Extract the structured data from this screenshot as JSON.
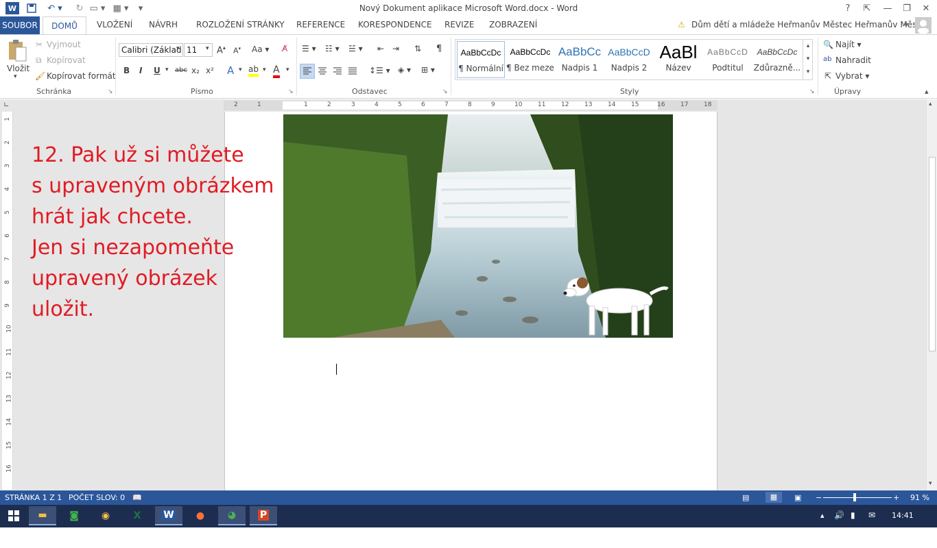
{
  "window": {
    "title": "Nový Dokument aplikace Microsoft Word.docx - Word",
    "help": "?",
    "min": "—",
    "max": "❐",
    "close": "✕"
  },
  "tabs": {
    "file": "SOUBOR",
    "items": [
      "DOMŮ",
      "VLOŽENÍ",
      "NÁVRH",
      "ROZLOŽENÍ STRÁNKY",
      "REFERENCE",
      "KORESPONDENCE",
      "REVIZE",
      "ZOBRAZENÍ"
    ],
    "account": "Dům dětí a mládeže Heřmanův Městec Heřmanův Městec"
  },
  "clipboard": {
    "paste": "Vložit",
    "cut": "Vyjmout",
    "copy": "Kopírovat",
    "format_painter": "Kopírovat formát",
    "label": "Schránka"
  },
  "font": {
    "name": "Calibri (Základ",
    "size": "11",
    "case": "Aa",
    "bold": "B",
    "italic": "I",
    "underline": "U",
    "strike": "abc",
    "sub": "x₂",
    "sup": "x²",
    "label": "Písmo"
  },
  "paragraph": {
    "label": "Odstavec",
    "pilcrow": "¶"
  },
  "styles": {
    "label": "Styly",
    "items": [
      {
        "preview": "AaBbCcDc",
        "name": "¶ Normální"
      },
      {
        "preview": "AaBbCcDc",
        "name": "¶ Bez mezer"
      },
      {
        "preview": "AaBbCc",
        "name": "Nadpis 1"
      },
      {
        "preview": "AaBbCcD",
        "name": "Nadpis 2"
      },
      {
        "preview": "AaBl",
        "name": "Název"
      },
      {
        "preview": "AaBbCcD",
        "name": "Podtitul"
      },
      {
        "preview": "AaBbCcDc",
        "name": "Zdůrazně..."
      }
    ]
  },
  "editing": {
    "find": "Najít",
    "replace": "Nahradit",
    "select": "Vybrat",
    "label": "Úpravy"
  },
  "ruler": {
    "numbers": [
      "2",
      "1",
      "1",
      "2",
      "3",
      "4",
      "5",
      "6",
      "7",
      "8",
      "9",
      "10",
      "11",
      "12",
      "13",
      "14",
      "15",
      "16",
      "17",
      "18"
    ],
    "vnumbers": [
      "1",
      "2",
      "3",
      "4",
      "5",
      "6",
      "7",
      "8",
      "9",
      "10",
      "11",
      "12",
      "13",
      "14",
      "15",
      "16"
    ]
  },
  "document": {
    "lines": [
      "12. Pak už si můžete",
      "s upraveným obrázkem",
      "hrát jak chcete.",
      "Jen si nezapomeňte",
      "upravený obrázek",
      "uložit."
    ],
    "text_color": "#e01b24"
  },
  "status": {
    "page": "STRÁNKA 1 Z 1",
    "words": "POČET SLOV: 0",
    "zoom": "91 %"
  },
  "taskbar": {
    "clock": "14:41",
    "apps": [
      "file-explorer",
      "store",
      "photos",
      "excel",
      "word",
      "firefox",
      "chrome",
      "powerpoint"
    ]
  },
  "colors": {
    "accent": "#2b579a",
    "taskbar": "#1d2d4f"
  }
}
